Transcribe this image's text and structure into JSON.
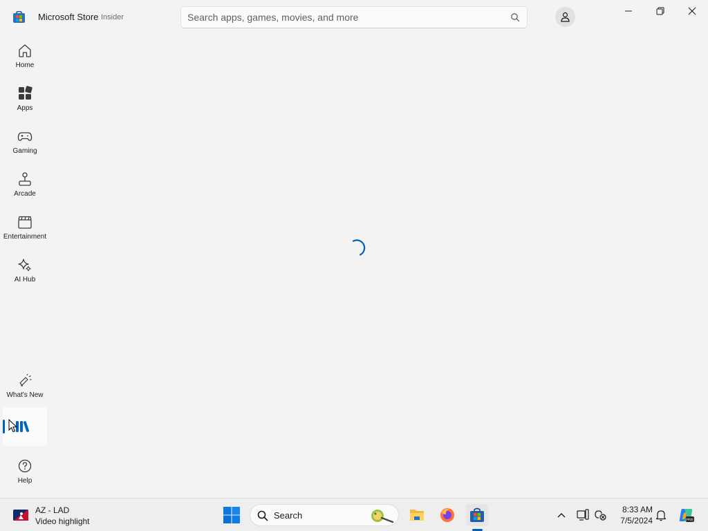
{
  "app": {
    "title": "Microsoft Store",
    "badge": "Insider"
  },
  "search": {
    "placeholder": "Search apps, games, movies, and more",
    "icon": "search-icon"
  },
  "window_controls": [
    "minimize",
    "maximize",
    "close"
  ],
  "nav": {
    "items": [
      {
        "label": "Home",
        "icon": "home-icon"
      },
      {
        "label": "Apps",
        "icon": "apps-icon"
      },
      {
        "label": "Gaming",
        "icon": "gamepad-icon"
      },
      {
        "label": "Arcade",
        "icon": "joystick-icon"
      },
      {
        "label": "Entertainment",
        "icon": "clapperboard-icon"
      },
      {
        "label": "AI Hub",
        "icon": "sparkle-icon"
      }
    ],
    "bottom": [
      {
        "label": "What's New",
        "icon": "megaphone-icon"
      },
      {
        "label": "Help",
        "icon": "help-icon"
      }
    ],
    "library_icon": "library-icon",
    "selected": "library"
  },
  "main": {
    "state": "loading"
  },
  "taskbar": {
    "widget": {
      "title": "AZ - LAD",
      "subtitle": "Video highlight"
    },
    "search_label": "Search",
    "clock": {
      "time": "8:33 AM",
      "date": "7/5/2024"
    }
  },
  "colors": {
    "accent": "#005fb8",
    "background": "#f3f3f3",
    "taskbar": "#eeeeee"
  }
}
